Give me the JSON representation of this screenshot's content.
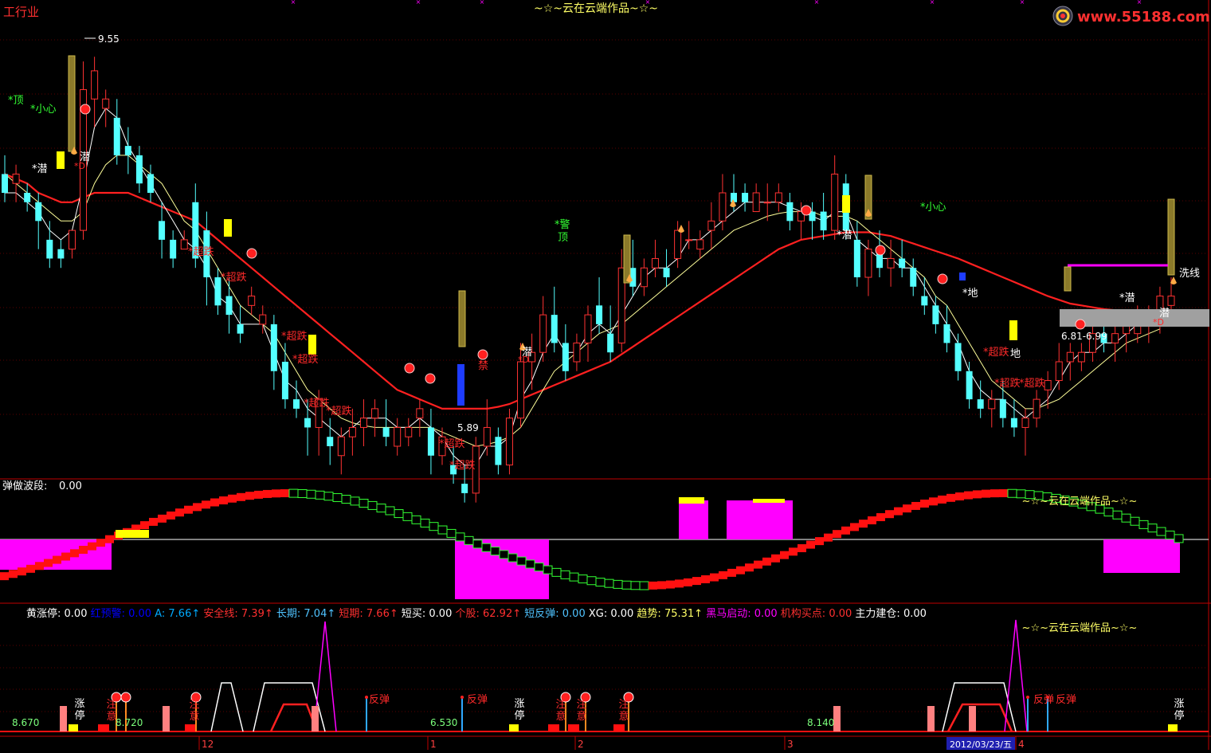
{
  "header": {
    "corner_label": "工行业",
    "main_title": "~☆~云在云端作品~☆~",
    "watermark": "www.55188.com",
    "watermark_icon": "swirl-logo-icon"
  },
  "main_panel": {
    "price_high_label": "9.55",
    "price_low_label": "5.89",
    "range_label": "6.81-6.99",
    "signals": {
      "top": "*顶",
      "careful": "*小心",
      "careful2": "*小心",
      "latent": "潜",
      "latent_star": "*潜",
      "oversold": "*超跌",
      "warning": "*警",
      "top2": "顶",
      "ground": "*地",
      "ground2": "地",
      "wash": "洗线",
      "d_mark": "*D",
      "prohibited": "禁"
    }
  },
  "mid_panel": {
    "title": "弹做波段:",
    "value": "0.00",
    "signature": "~☆~云在云端作品~☆~"
  },
  "indicators": [
    {
      "label": "黄涨停:",
      "value": "0.00",
      "color": "#ffffff",
      "arrow": ""
    },
    {
      "label": "红预警:",
      "value": "0.00",
      "color": "#0000ff",
      "arrow": ""
    },
    {
      "label": "A:",
      "value": "7.66",
      "color": "#00aaff",
      "arrow": "↑"
    },
    {
      "label": "安全线:",
      "value": "7.39",
      "color": "#ff3030",
      "arrow": "↑"
    },
    {
      "label": "长期:",
      "value": "7.04",
      "color": "#4fc3ff",
      "arrow": "↑"
    },
    {
      "label": "短期:",
      "value": "7.66",
      "color": "#ff3030",
      "arrow": "↑"
    },
    {
      "label": "短买:",
      "value": "0.00",
      "color": "#ffffff",
      "arrow": ""
    },
    {
      "label": "个股:",
      "value": "62.92",
      "color": "#ff3030",
      "arrow": "↑"
    },
    {
      "label": "短反弹:",
      "value": "0.00",
      "color": "#4fc3ff",
      "arrow": ""
    },
    {
      "label": "XG:",
      "value": "0.00",
      "color": "#ffffff",
      "arrow": ""
    },
    {
      "label": "趋势:",
      "value": "75.31",
      "color": "#ffff66",
      "arrow": "↑"
    },
    {
      "label": "黑马启动:",
      "value": "0.00",
      "color": "#ff00ff",
      "arrow": ""
    },
    {
      "label": "机构买点:",
      "value": "0.00",
      "color": "#ff3030",
      "arrow": ""
    },
    {
      "label": "主力建仓:",
      "value": "0.00",
      "color": "#ffffff",
      "arrow": ""
    }
  ],
  "bottom_panel": {
    "signature": "~☆~云在云端作品~☆~",
    "value_labels": [
      "8.670",
      "8.720",
      "6.530",
      "8.140"
    ],
    "text_signals": {
      "limit_up": "涨停",
      "rebound": "反弹",
      "build": "注意"
    }
  },
  "axis": {
    "month_ticks": [
      "12",
      "1",
      "2",
      "3",
      "4"
    ],
    "cursor_date": "2012/03/23/五"
  },
  "colors": {
    "up": "#ff3232",
    "down": "#54ffff",
    "ma_long": "#ff2020",
    "ma_short": "#ffffff",
    "ma_mid": "#ffff9a",
    "magenta": "#ff00ff",
    "yellow": "#ffff00",
    "green_label": "#33ff33"
  },
  "chart_data": {
    "type": "candlestick",
    "title": "~☆~云在云端作品~☆~",
    "y_range": [
      5.4,
      9.9
    ],
    "annotated_extremes": {
      "high": 9.55,
      "low": 5.89
    },
    "candles": [
      [
        8.3,
        8.5,
        8.0,
        8.1
      ],
      [
        8.2,
        8.4,
        8.0,
        8.3
      ],
      [
        8.1,
        8.2,
        7.9,
        8.0
      ],
      [
        8.0,
        8.1,
        7.5,
        7.8
      ],
      [
        7.6,
        7.8,
        7.3,
        7.4
      ],
      [
        7.5,
        7.6,
        7.3,
        7.4
      ],
      [
        7.5,
        7.7,
        7.4,
        7.7
      ],
      [
        7.7,
        9.5,
        7.6,
        9.2
      ],
      [
        9.1,
        9.55,
        8.8,
        9.4
      ],
      [
        9.0,
        9.2,
        8.8,
        9.1
      ],
      [
        8.9,
        9.1,
        8.4,
        8.5
      ],
      [
        8.6,
        8.8,
        8.3,
        8.5
      ],
      [
        8.5,
        8.6,
        8.1,
        8.2
      ],
      [
        8.3,
        8.4,
        8.0,
        8.1
      ],
      [
        7.8,
        8.0,
        7.4,
        7.6
      ],
      [
        7.6,
        7.7,
        7.3,
        7.4
      ],
      [
        7.5,
        7.7,
        7.5,
        7.6
      ],
      [
        8.0,
        8.2,
        7.3,
        7.4
      ],
      [
        7.7,
        7.9,
        6.9,
        7.2
      ],
      [
        7.2,
        7.3,
        6.8,
        6.9
      ],
      [
        7.0,
        7.2,
        6.6,
        6.8
      ],
      [
        6.7,
        6.9,
        6.5,
        6.6
      ],
      [
        6.9,
        7.1,
        6.8,
        7.0
      ],
      [
        6.7,
        6.9,
        6.6,
        6.8
      ],
      [
        6.7,
        6.8,
        6.0,
        6.2
      ],
      [
        6.3,
        6.5,
        5.8,
        5.9
      ],
      [
        5.9,
        6.1,
        5.7,
        5.8
      ],
      [
        5.7,
        5.9,
        5.3,
        5.6
      ],
      [
        5.6,
        6.0,
        5.3,
        5.9
      ],
      [
        5.5,
        5.7,
        5.2,
        5.4
      ],
      [
        5.3,
        5.6,
        5.1,
        5.5
      ],
      [
        5.5,
        5.8,
        5.3,
        5.6
      ],
      [
        5.6,
        5.9,
        5.4,
        5.7
      ],
      [
        5.7,
        5.9,
        5.5,
        5.8
      ],
      [
        5.6,
        5.9,
        5.4,
        5.5
      ],
      [
        5.4,
        5.7,
        5.3,
        5.6
      ],
      [
        5.5,
        5.7,
        5.4,
        5.6
      ],
      [
        5.7,
        5.9,
        5.5,
        5.8
      ],
      [
        5.6,
        5.8,
        5.1,
        5.3
      ],
      [
        5.3,
        5.6,
        5.2,
        5.5
      ],
      [
        5.2,
        5.4,
        5.0,
        5.1
      ],
      [
        5.0,
        5.2,
        4.8,
        4.9
      ],
      [
        4.9,
        5.5,
        4.8,
        5.4
      ],
      [
        5.4,
        5.9,
        5.3,
        5.6
      ],
      [
        5.5,
        5.6,
        5.1,
        5.2
      ],
      [
        5.2,
        5.8,
        5.1,
        5.7
      ],
      [
        5.7,
        6.5,
        5.6,
        6.3
      ],
      [
        6.3,
        6.6,
        6.0,
        6.4
      ],
      [
        6.4,
        7.0,
        6.3,
        6.8
      ],
      [
        6.8,
        7.1,
        6.4,
        6.5
      ],
      [
        6.5,
        6.7,
        6.1,
        6.2
      ],
      [
        6.3,
        6.6,
        6.2,
        6.5
      ],
      [
        6.5,
        6.9,
        6.3,
        6.8
      ],
      [
        6.9,
        7.2,
        6.6,
        6.7
      ],
      [
        6.6,
        6.9,
        6.3,
        6.4
      ],
      [
        6.5,
        7.5,
        6.4,
        7.3
      ],
      [
        7.3,
        7.6,
        7.0,
        7.1
      ],
      [
        7.1,
        7.4,
        7.0,
        7.3
      ],
      [
        7.3,
        7.6,
        7.2,
        7.4
      ],
      [
        7.3,
        7.5,
        7.1,
        7.2
      ],
      [
        7.4,
        7.8,
        7.3,
        7.7
      ],
      [
        7.6,
        7.8,
        7.5,
        7.6
      ],
      [
        7.5,
        7.7,
        7.4,
        7.6
      ],
      [
        7.7,
        8.0,
        7.5,
        7.8
      ],
      [
        7.8,
        8.3,
        7.7,
        8.1
      ],
      [
        8.1,
        8.3,
        7.9,
        8.0
      ],
      [
        8.1,
        8.2,
        7.9,
        8.0
      ],
      [
        7.9,
        8.2,
        7.9,
        8.1
      ],
      [
        8.0,
        8.2,
        7.8,
        8.0
      ],
      [
        8.0,
        8.2,
        7.9,
        8.1
      ],
      [
        8.0,
        8.1,
        7.7,
        7.8
      ],
      [
        7.8,
        8.0,
        7.6,
        7.9
      ],
      [
        7.9,
        8.0,
        7.6,
        7.8
      ],
      [
        7.9,
        8.1,
        7.6,
        7.7
      ],
      [
        7.7,
        8.5,
        7.6,
        8.3
      ],
      [
        8.2,
        8.3,
        7.6,
        7.7
      ],
      [
        7.6,
        7.8,
        7.1,
        7.2
      ],
      [
        7.2,
        7.6,
        7.0,
        7.5
      ],
      [
        7.5,
        7.7,
        7.2,
        7.3
      ],
      [
        7.3,
        7.6,
        7.1,
        7.4
      ],
      [
        7.4,
        7.6,
        7.2,
        7.3
      ],
      [
        7.3,
        7.4,
        7.0,
        7.1
      ],
      [
        7.0,
        7.2,
        6.8,
        6.9
      ],
      [
        6.9,
        7.0,
        6.6,
        6.7
      ],
      [
        6.7,
        6.9,
        6.4,
        6.5
      ],
      [
        6.5,
        6.6,
        6.1,
        6.2
      ],
      [
        6.2,
        6.3,
        5.8,
        5.9
      ],
      [
        5.9,
        6.1,
        5.7,
        5.8
      ],
      [
        5.8,
        6.0,
        5.6,
        5.9
      ],
      [
        5.9,
        6.1,
        5.6,
        5.7
      ],
      [
        5.7,
        5.9,
        5.5,
        5.6
      ],
      [
        5.6,
        5.8,
        5.3,
        5.7
      ],
      [
        5.7,
        6.0,
        5.6,
        5.9
      ],
      [
        6.0,
        6.2,
        5.8,
        6.1
      ],
      [
        6.1,
        6.5,
        6.0,
        6.3
      ],
      [
        6.3,
        6.5,
        6.1,
        6.4
      ],
      [
        6.3,
        6.5,
        6.2,
        6.4
      ],
      [
        6.4,
        6.7,
        6.3,
        6.6
      ],
      [
        6.6,
        6.8,
        6.4,
        6.5
      ],
      [
        6.5,
        6.7,
        6.3,
        6.6
      ],
      [
        6.6,
        6.8,
        6.4,
        6.7
      ],
      [
        6.6,
        6.9,
        6.5,
        6.8
      ],
      [
        6.7,
        6.9,
        6.5,
        6.8
      ],
      [
        6.8,
        7.1,
        6.6,
        7.0
      ],
      [
        6.9,
        7.2,
        6.8,
        7.0
      ]
    ],
    "ma_long": [
      8.3,
      8.25,
      8.2,
      8.1,
      8.05,
      8.0,
      8.0,
      8.05,
      8.1,
      8.1,
      8.1,
      8.1,
      8.05,
      8.0,
      7.95,
      7.9,
      7.85,
      7.8,
      7.7,
      7.6,
      7.5,
      7.4,
      7.3,
      7.2,
      7.1,
      7.0,
      6.9,
      6.8,
      6.7,
      6.6,
      6.5,
      6.4,
      6.3,
      6.2,
      6.1,
      6.0,
      5.95,
      5.9,
      5.85,
      5.8,
      5.8,
      5.8,
      5.8,
      5.8,
      5.82,
      5.85,
      5.9,
      5.95,
      6.0,
      6.05,
      6.1,
      6.15,
      6.2,
      6.25,
      6.3,
      6.38,
      6.46,
      6.54,
      6.62,
      6.7,
      6.78,
      6.86,
      6.94,
      7.02,
      7.1,
      7.18,
      7.26,
      7.34,
      7.42,
      7.5,
      7.55,
      7.6,
      7.62,
      7.64,
      7.66,
      7.68,
      7.68,
      7.68,
      7.66,
      7.64,
      7.6,
      7.56,
      7.52,
      7.48,
      7.44,
      7.4,
      7.35,
      7.3,
      7.25,
      7.2,
      7.15,
      7.1,
      7.05,
      7.0,
      6.96,
      6.92,
      6.9,
      6.88,
      6.86,
      6.85,
      6.84,
      6.84,
      6.84,
      6.85
    ],
    "ma_short": [
      8.1,
      8.1,
      8.0,
      7.9,
      7.7,
      7.6,
      7.7,
      8.2,
      8.8,
      9.0,
      8.9,
      8.6,
      8.4,
      8.2,
      8.0,
      7.8,
      7.6,
      7.5,
      7.3,
      7.0,
      6.9,
      6.7,
      6.7,
      6.7,
      6.4,
      6.1,
      6.0,
      5.8,
      5.7,
      5.6,
      5.5,
      5.6,
      5.7,
      5.7,
      5.7,
      5.6,
      5.6,
      5.7,
      5.6,
      5.5,
      5.3,
      5.2,
      5.2,
      5.4,
      5.4,
      5.5,
      5.9,
      6.1,
      6.4,
      6.6,
      6.4,
      6.4,
      6.6,
      6.7,
      6.6,
      6.8,
      7.0,
      7.2,
      7.3,
      7.3,
      7.4,
      7.6,
      7.6,
      7.7,
      7.8,
      7.9,
      8.0,
      8.0,
      8.0,
      8.0,
      7.95,
      7.9,
      7.85,
      7.8,
      7.9,
      7.9,
      7.6,
      7.5,
      7.4,
      7.4,
      7.3,
      7.3,
      7.1,
      6.9,
      6.7,
      6.5,
      6.2,
      6.0,
      5.9,
      5.9,
      5.8,
      5.7,
      5.8,
      5.9,
      6.1,
      6.3,
      6.4,
      6.4,
      6.5,
      6.5,
      6.6,
      6.7,
      6.7,
      6.8
    ],
    "ma_mid": [
      8.3,
      8.2,
      8.1,
      8.0,
      7.9,
      7.8,
      7.8,
      7.9,
      8.2,
      8.4,
      8.5,
      8.5,
      8.4,
      8.3,
      8.2,
      8.0,
      7.8,
      7.7,
      7.5,
      7.3,
      7.1,
      6.9,
      6.8,
      6.7,
      6.6,
      6.4,
      6.2,
      6.0,
      5.9,
      5.8,
      5.7,
      5.65,
      5.62,
      5.6,
      5.6,
      5.6,
      5.6,
      5.6,
      5.6,
      5.55,
      5.5,
      5.45,
      5.4,
      5.42,
      5.45,
      5.5,
      5.6,
      5.8,
      6.0,
      6.2,
      6.3,
      6.4,
      6.5,
      6.6,
      6.65,
      6.7,
      6.8,
      6.9,
      7.0,
      7.1,
      7.2,
      7.3,
      7.4,
      7.5,
      7.6,
      7.7,
      7.75,
      7.8,
      7.85,
      7.88,
      7.9,
      7.9,
      7.9,
      7.85,
      7.85,
      7.85,
      7.8,
      7.7,
      7.6,
      7.5,
      7.4,
      7.3,
      7.2,
      7.0,
      6.9,
      6.7,
      6.5,
      6.3,
      6.1,
      6.0,
      5.9,
      5.8,
      5.8,
      5.85,
      5.9,
      6.0,
      6.1,
      6.2,
      6.3,
      6.4,
      6.5,
      6.55,
      6.6,
      6.65
    ]
  }
}
